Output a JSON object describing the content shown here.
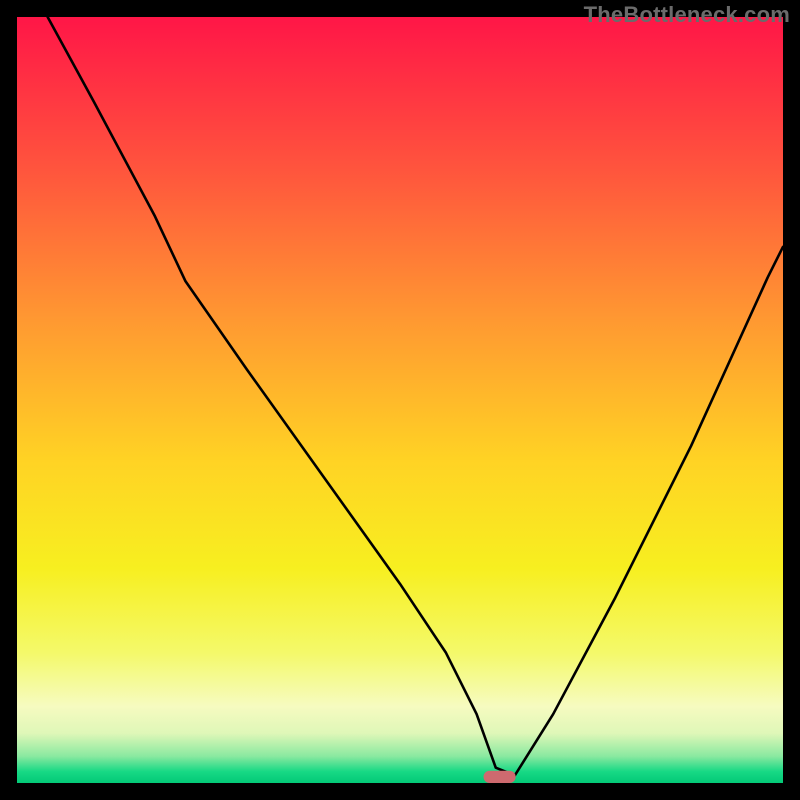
{
  "watermark": "TheBottleneck.com",
  "chart_data": {
    "type": "line",
    "title": "",
    "xlabel": "",
    "ylabel": "",
    "xlim": [
      0,
      100
    ],
    "ylim": [
      0,
      100
    ],
    "grid": false,
    "legend": false,
    "series": [
      {
        "name": "curve",
        "x": [
          4,
          10,
          18,
          22,
          30,
          40,
          50,
          56,
          60,
          62.5,
          65,
          70,
          78,
          88,
          98,
          100
        ],
        "values": [
          100,
          89,
          74,
          65.5,
          54,
          40,
          26,
          17,
          9,
          2,
          1,
          9,
          24,
          44,
          66,
          70
        ]
      }
    ],
    "marker": {
      "x": 63,
      "y": 0.8,
      "width_pct": 4.2,
      "height_pct": 1.6,
      "color": "#ce6a6f",
      "rx_pct": 0.8
    },
    "gradient_stops": [
      {
        "offset": 0.0,
        "color": "#ff1647"
      },
      {
        "offset": 0.2,
        "color": "#ff553d"
      },
      {
        "offset": 0.4,
        "color": "#ff9a31"
      },
      {
        "offset": 0.58,
        "color": "#ffd324"
      },
      {
        "offset": 0.72,
        "color": "#f7ef20"
      },
      {
        "offset": 0.83,
        "color": "#f4f96a"
      },
      {
        "offset": 0.9,
        "color": "#f6fbc0"
      },
      {
        "offset": 0.935,
        "color": "#dff7b8"
      },
      {
        "offset": 0.965,
        "color": "#8ae9a0"
      },
      {
        "offset": 0.985,
        "color": "#17d985"
      },
      {
        "offset": 1.0,
        "color": "#03c977"
      }
    ]
  }
}
